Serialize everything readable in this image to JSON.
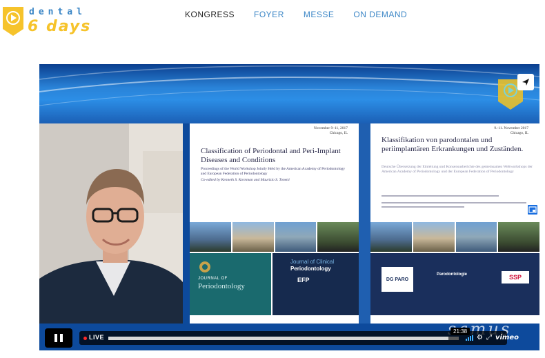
{
  "logo": {
    "line1": "dental",
    "line2": "6 days"
  },
  "nav": {
    "items": [
      {
        "label": "KONGRESS",
        "active": true
      },
      {
        "label": "FOYER",
        "active": false
      },
      {
        "label": "MESSE",
        "active": false
      },
      {
        "label": "ON DEMAND",
        "active": false
      }
    ]
  },
  "player": {
    "slide_left": {
      "date": "November 9–11, 2017",
      "location": "Chicago, IL",
      "title": "Classification of Periodontal and Peri-Implant Diseases and Conditions",
      "subtitle": "Proceedings of the World Workshop Jointly Held by the American Academy of Periodontology and European Federation of Periodontology",
      "coeditors": "Co-edited by Kenneth S. Kornman and Maurizio S. Tonetti",
      "journal1": {
        "top": "JOURNAL OF",
        "name": "Periodontology"
      },
      "journal2": {
        "top": "Journal of Clinical",
        "name": "Periodontology",
        "org": "EFP"
      }
    },
    "slide_right": {
      "date": "9.-11. November 2017",
      "location": "Chicago, IL",
      "title": "Klassifikation von parodontalen und periimplantären Erkrankungen und Zuständen.",
      "subtitle": "Deutsche Übersetzung der Einleitung und Konsensusberichte des gemeinsamen Weltworkshops der American Academy of Periodontology und der European Federation of Periodontology",
      "logos": [
        "DG PARO",
        "Parodontologie",
        "SSP"
      ]
    },
    "watermark": "samus",
    "controls": {
      "live_label": "LIVE",
      "timecode": "21:38",
      "progress": 0.97,
      "vimeo": "vimeo"
    }
  },
  "colors": {
    "accent": "#3b86c6",
    "brand_yellow": "#f6c32b",
    "live_red": "#ff2a2a"
  }
}
